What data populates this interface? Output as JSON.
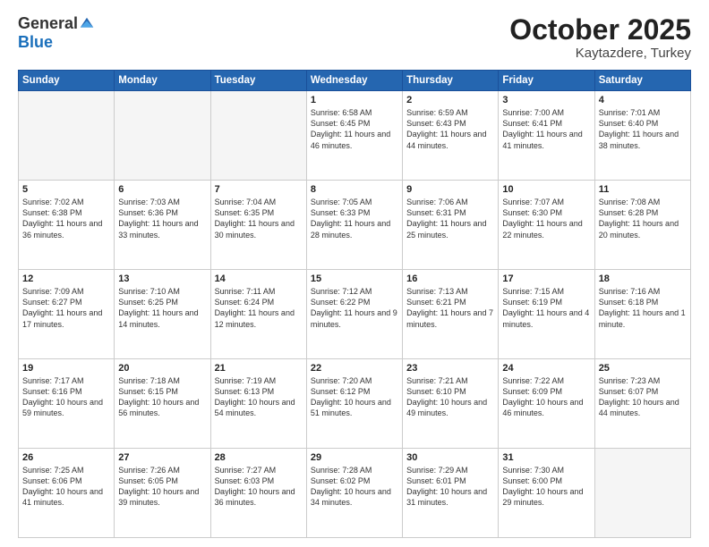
{
  "logo": {
    "general": "General",
    "blue": "Blue"
  },
  "title": "October 2025",
  "subtitle": "Kaytazdere, Turkey",
  "days": [
    "Sunday",
    "Monday",
    "Tuesday",
    "Wednesday",
    "Thursday",
    "Friday",
    "Saturday"
  ],
  "weeks": [
    [
      {
        "day": null
      },
      {
        "day": null
      },
      {
        "day": null
      },
      {
        "day": "1",
        "sunrise": "6:58 AM",
        "sunset": "6:45 PM",
        "daylight": "11 hours and 46 minutes."
      },
      {
        "day": "2",
        "sunrise": "6:59 AM",
        "sunset": "6:43 PM",
        "daylight": "11 hours and 44 minutes."
      },
      {
        "day": "3",
        "sunrise": "7:00 AM",
        "sunset": "6:41 PM",
        "daylight": "11 hours and 41 minutes."
      },
      {
        "day": "4",
        "sunrise": "7:01 AM",
        "sunset": "6:40 PM",
        "daylight": "11 hours and 38 minutes."
      }
    ],
    [
      {
        "day": "5",
        "sunrise": "7:02 AM",
        "sunset": "6:38 PM",
        "daylight": "11 hours and 36 minutes."
      },
      {
        "day": "6",
        "sunrise": "7:03 AM",
        "sunset": "6:36 PM",
        "daylight": "11 hours and 33 minutes."
      },
      {
        "day": "7",
        "sunrise": "7:04 AM",
        "sunset": "6:35 PM",
        "daylight": "11 hours and 30 minutes."
      },
      {
        "day": "8",
        "sunrise": "7:05 AM",
        "sunset": "6:33 PM",
        "daylight": "11 hours and 28 minutes."
      },
      {
        "day": "9",
        "sunrise": "7:06 AM",
        "sunset": "6:31 PM",
        "daylight": "11 hours and 25 minutes."
      },
      {
        "day": "10",
        "sunrise": "7:07 AM",
        "sunset": "6:30 PM",
        "daylight": "11 hours and 22 minutes."
      },
      {
        "day": "11",
        "sunrise": "7:08 AM",
        "sunset": "6:28 PM",
        "daylight": "11 hours and 20 minutes."
      }
    ],
    [
      {
        "day": "12",
        "sunrise": "7:09 AM",
        "sunset": "6:27 PM",
        "daylight": "11 hours and 17 minutes."
      },
      {
        "day": "13",
        "sunrise": "7:10 AM",
        "sunset": "6:25 PM",
        "daylight": "11 hours and 14 minutes."
      },
      {
        "day": "14",
        "sunrise": "7:11 AM",
        "sunset": "6:24 PM",
        "daylight": "11 hours and 12 minutes."
      },
      {
        "day": "15",
        "sunrise": "7:12 AM",
        "sunset": "6:22 PM",
        "daylight": "11 hours and 9 minutes."
      },
      {
        "day": "16",
        "sunrise": "7:13 AM",
        "sunset": "6:21 PM",
        "daylight": "11 hours and 7 minutes."
      },
      {
        "day": "17",
        "sunrise": "7:15 AM",
        "sunset": "6:19 PM",
        "daylight": "11 hours and 4 minutes."
      },
      {
        "day": "18",
        "sunrise": "7:16 AM",
        "sunset": "6:18 PM",
        "daylight": "11 hours and 1 minute."
      }
    ],
    [
      {
        "day": "19",
        "sunrise": "7:17 AM",
        "sunset": "6:16 PM",
        "daylight": "10 hours and 59 minutes."
      },
      {
        "day": "20",
        "sunrise": "7:18 AM",
        "sunset": "6:15 PM",
        "daylight": "10 hours and 56 minutes."
      },
      {
        "day": "21",
        "sunrise": "7:19 AM",
        "sunset": "6:13 PM",
        "daylight": "10 hours and 54 minutes."
      },
      {
        "day": "22",
        "sunrise": "7:20 AM",
        "sunset": "6:12 PM",
        "daylight": "10 hours and 51 minutes."
      },
      {
        "day": "23",
        "sunrise": "7:21 AM",
        "sunset": "6:10 PM",
        "daylight": "10 hours and 49 minutes."
      },
      {
        "day": "24",
        "sunrise": "7:22 AM",
        "sunset": "6:09 PM",
        "daylight": "10 hours and 46 minutes."
      },
      {
        "day": "25",
        "sunrise": "7:23 AM",
        "sunset": "6:07 PM",
        "daylight": "10 hours and 44 minutes."
      }
    ],
    [
      {
        "day": "26",
        "sunrise": "7:25 AM",
        "sunset": "6:06 PM",
        "daylight": "10 hours and 41 minutes."
      },
      {
        "day": "27",
        "sunrise": "7:26 AM",
        "sunset": "6:05 PM",
        "daylight": "10 hours and 39 minutes."
      },
      {
        "day": "28",
        "sunrise": "7:27 AM",
        "sunset": "6:03 PM",
        "daylight": "10 hours and 36 minutes."
      },
      {
        "day": "29",
        "sunrise": "7:28 AM",
        "sunset": "6:02 PM",
        "daylight": "10 hours and 34 minutes."
      },
      {
        "day": "30",
        "sunrise": "7:29 AM",
        "sunset": "6:01 PM",
        "daylight": "10 hours and 31 minutes."
      },
      {
        "day": "31",
        "sunrise": "7:30 AM",
        "sunset": "6:00 PM",
        "daylight": "10 hours and 29 minutes."
      },
      {
        "day": null
      }
    ]
  ],
  "labels": {
    "sunrise": "Sunrise:",
    "sunset": "Sunset:",
    "daylight": "Daylight:"
  }
}
